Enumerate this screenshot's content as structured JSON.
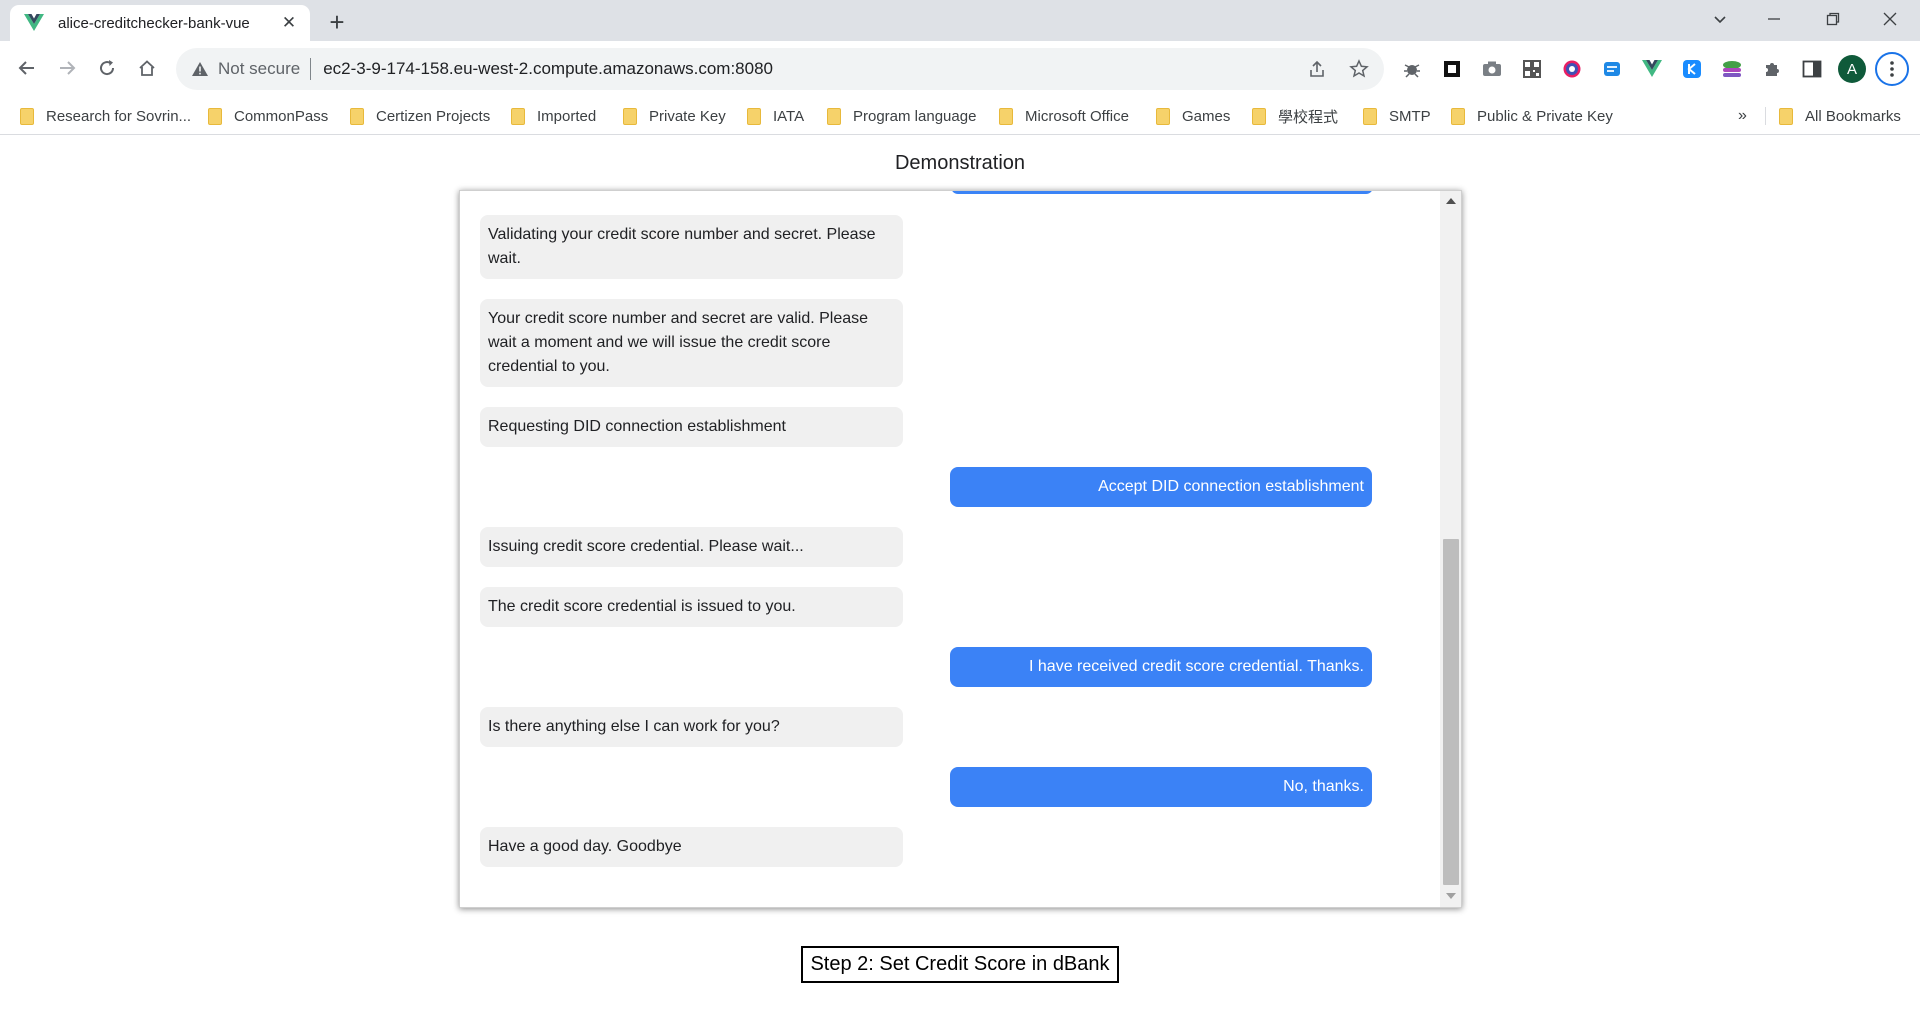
{
  "browser": {
    "tab_title": "alice-creditchecker-bank-vue",
    "tab_close": "✕",
    "new_tab": "+",
    "security_label": "Not secure",
    "url": "ec2-3-9-174-158.eu-west-2.compute.amazonaws.com:8080",
    "profile_initial": "A",
    "bookmarks": [
      "Research for Sovrin...",
      "CommonPass",
      "Certizen Projects",
      "Imported",
      "Private Key",
      "IATA",
      "Program language",
      "Microsoft Office",
      "Games",
      "學校程式",
      "SMTP",
      "Public & Private Key"
    ],
    "bookmarks_overflow": "»",
    "all_bookmarks": "All Bookmarks"
  },
  "page": {
    "title": "Demonstration",
    "messages": [
      {
        "from": "bank",
        "text": "Validating your credit score number and secret. Please wait."
      },
      {
        "from": "bank",
        "text": "Your credit score number and secret are valid. Please wait a moment and we will issue the credit score credential to you."
      },
      {
        "from": "bank",
        "text": "Requesting DID connection establishment"
      },
      {
        "from": "user",
        "text": "Accept DID connection establishment"
      },
      {
        "from": "bank",
        "text": "Issuing credit score credential. Please wait..."
      },
      {
        "from": "bank",
        "text": "The credit score credential is issued to you."
      },
      {
        "from": "user",
        "text": "I have received credit score credential. Thanks."
      },
      {
        "from": "bank",
        "text": "Is there anything else I can work for you?"
      },
      {
        "from": "user",
        "text": "No, thanks."
      },
      {
        "from": "bank",
        "text": "Have a good day. Goodbye"
      }
    ],
    "step_button": "Step 2: Set Credit Score in dBank"
  },
  "colors": {
    "user_bubble": "#3b82f6",
    "bank_bubble": "#f0f0f0",
    "vue_green": "#41b883",
    "vue_dark": "#34495e"
  }
}
